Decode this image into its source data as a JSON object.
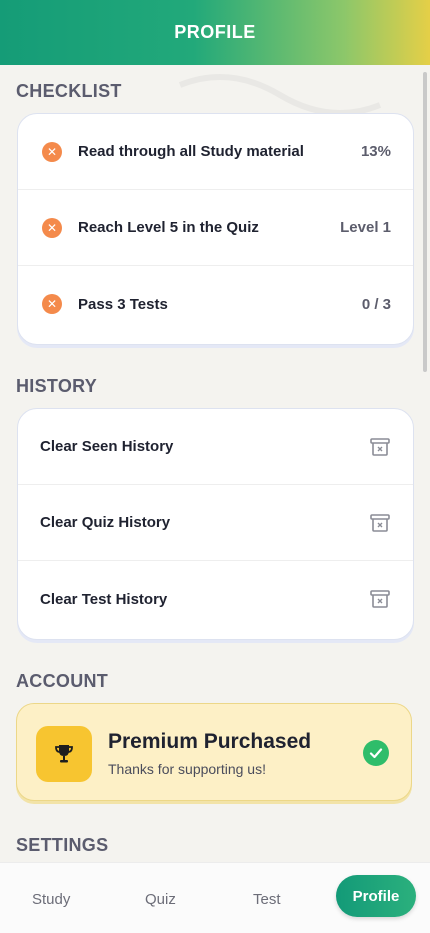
{
  "header": {
    "title": "PROFILE"
  },
  "checklist": {
    "title": "CHECKLIST",
    "items": [
      {
        "label": "Read through all Study material",
        "value": "13%"
      },
      {
        "label": "Reach Level 5 in the Quiz",
        "value": "Level 1"
      },
      {
        "label": "Pass 3 Tests",
        "value": "0 / 3"
      }
    ]
  },
  "history": {
    "title": "HISTORY",
    "items": [
      {
        "label": "Clear Seen History"
      },
      {
        "label": "Clear Quiz History"
      },
      {
        "label": "Clear Test History"
      }
    ]
  },
  "account": {
    "title": "ACCOUNT",
    "premium_title": "Premium Purchased",
    "premium_subtitle": "Thanks for supporting us!"
  },
  "settings": {
    "title": "SETTINGS"
  },
  "tabs": [
    {
      "label": "Study"
    },
    {
      "label": "Quiz"
    },
    {
      "label": "Test"
    },
    {
      "label": "Profile",
      "active": true
    }
  ],
  "colors": {
    "accent_green": "#159c77",
    "accent_yellow": "#e5cf47",
    "status_x": "#f48a4b",
    "success": "#2fbd6a"
  }
}
